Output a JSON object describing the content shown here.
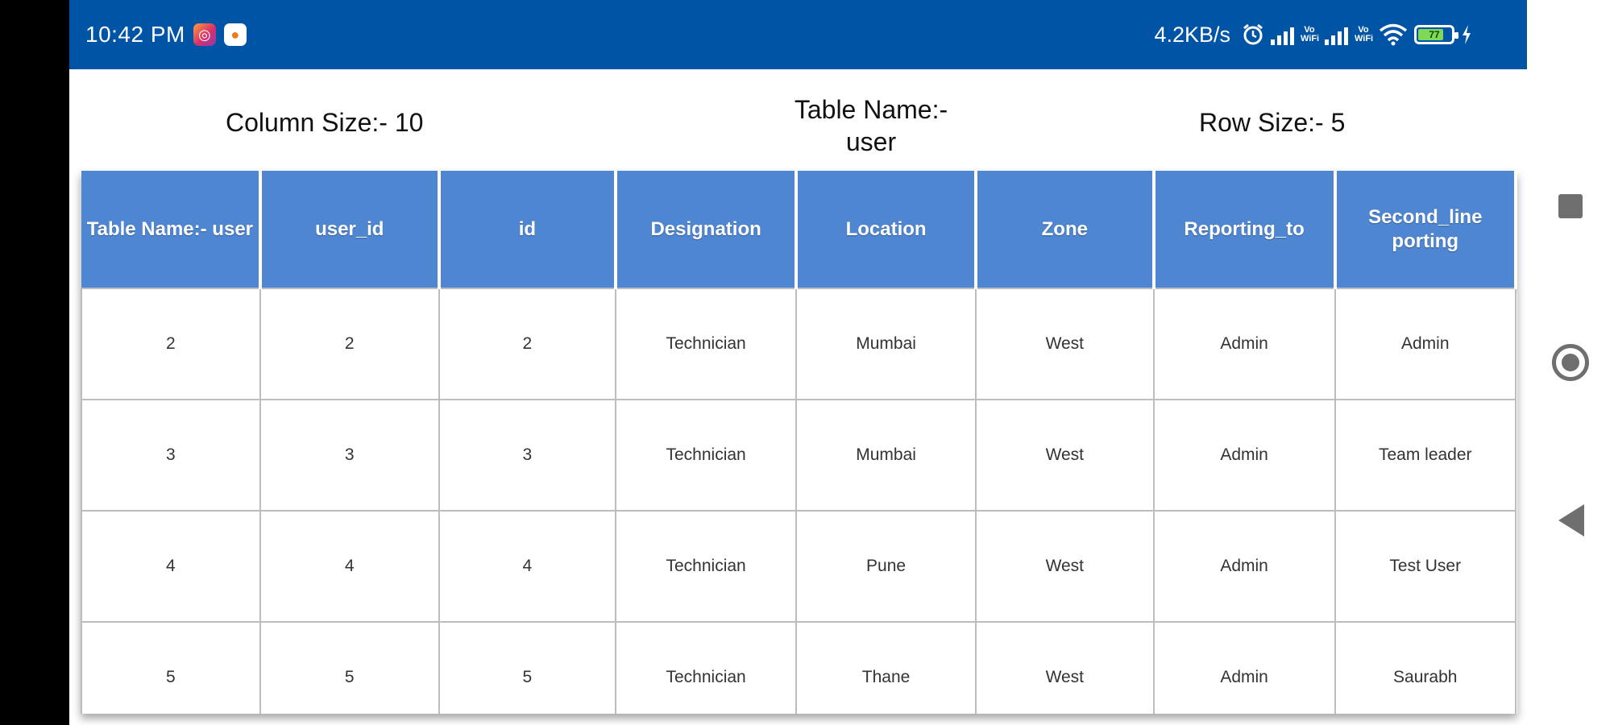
{
  "status_bar": {
    "time": "10:42 PM",
    "net_speed": "4.2KB/s",
    "volte_1": "Vo WiFi",
    "volte_2": "Vo WiFi",
    "battery_level": "77",
    "icons": [
      "instagram-icon",
      "app-notification-icon",
      "alarm-icon",
      "signal-icon",
      "wifi-icon",
      "battery-icon",
      "charging-icon"
    ]
  },
  "info": {
    "column_size": "Column Size:- 10",
    "table_name_line1": "Table Name:-",
    "table_name_line2": "user",
    "row_size": "Row Size:- 5"
  },
  "table": {
    "headers": [
      "Table Name:- user",
      "user_id",
      "id",
      "Designation",
      "Location",
      "Zone",
      "Reporting_to",
      "Second_line porting"
    ],
    "rows": [
      [
        "2",
        "2",
        "2",
        "Technician",
        "Mumbai",
        "West",
        "Admin",
        "Admin"
      ],
      [
        "3",
        "3",
        "3",
        "Technician",
        "Mumbai",
        "West",
        "Admin",
        "Team leader"
      ],
      [
        "4",
        "4",
        "4",
        "Technician",
        "Pune",
        "West",
        "Admin",
        "Test User"
      ],
      [
        "5",
        "5",
        "5",
        "Technician",
        "Thane",
        "West",
        "Admin",
        "Saurabh"
      ]
    ]
  },
  "colors": {
    "status_bar": "#0054a6",
    "header_bg": "#4f86d1",
    "nav_icons": "#6f6f6f"
  }
}
